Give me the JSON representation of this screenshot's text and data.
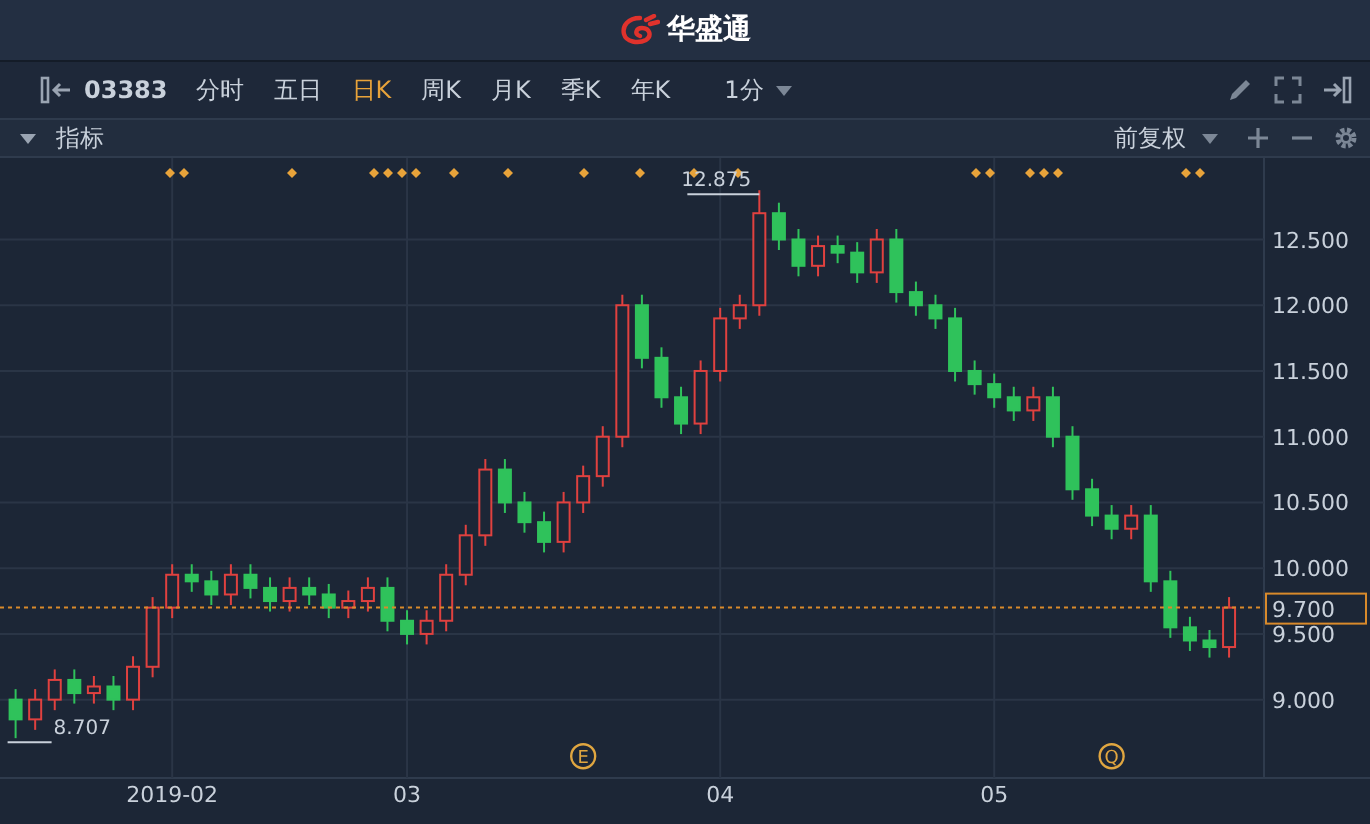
{
  "header": {
    "brand": "华盛通"
  },
  "toolbar": {
    "symbol": "03383",
    "tabs": [
      {
        "label": "分时",
        "selected": false
      },
      {
        "label": "五日",
        "selected": false
      },
      {
        "label": "日K",
        "selected": true
      },
      {
        "label": "周K",
        "selected": false
      },
      {
        "label": "月K",
        "selected": false
      },
      {
        "label": "季K",
        "selected": false
      },
      {
        "label": "年K",
        "selected": false
      }
    ],
    "interval": "1分"
  },
  "indicator_bar": {
    "label": "指标",
    "adjustment": "前复权"
  },
  "chart": {
    "chart_data": {
      "type": "candlestick",
      "grid": true,
      "ylim": [
        8.404,
        13.12
      ],
      "yticks": [
        {
          "value": 9,
          "label": "9.000"
        },
        {
          "value": 9.5,
          "label": "9.500"
        },
        {
          "value": 10,
          "label": "10.000"
        },
        {
          "value": 10.5,
          "label": "10.500"
        },
        {
          "value": 11,
          "label": "11.000"
        },
        {
          "value": 11.5,
          "label": "11.500"
        },
        {
          "value": 12,
          "label": "12.000"
        },
        {
          "value": 12.5,
          "label": "12.500"
        }
      ],
      "categories": [
        null,
        null,
        null,
        null,
        null,
        null,
        null,
        null,
        "2019-02",
        null,
        null,
        null,
        null,
        null,
        null,
        null,
        null,
        null,
        null,
        null,
        "03",
        null,
        null,
        null,
        null,
        null,
        null,
        null,
        null,
        null,
        null,
        null,
        null,
        null,
        null,
        null,
        "04",
        null,
        null,
        null,
        null,
        null,
        null,
        null,
        null,
        null,
        null,
        null,
        null,
        null,
        "05",
        null,
        null,
        null,
        null,
        null,
        null,
        null,
        null,
        null,
        null,
        null,
        null
      ],
      "ohlc": [
        [
          9.0,
          9.08,
          8.707,
          8.85
        ],
        [
          8.85,
          9.08,
          8.77,
          9.0
        ],
        [
          9.0,
          9.23,
          8.92,
          9.15
        ],
        [
          9.15,
          9.23,
          8.97,
          9.05
        ],
        [
          9.05,
          9.18,
          8.97,
          9.1
        ],
        [
          9.1,
          9.18,
          8.92,
          9.0
        ],
        [
          9.0,
          9.33,
          8.92,
          9.25
        ],
        [
          9.25,
          9.78,
          9.17,
          9.7
        ],
        [
          9.7,
          10.03,
          9.62,
          9.95
        ],
        [
          9.95,
          10.03,
          9.82,
          9.9
        ],
        [
          9.9,
          9.98,
          9.72,
          9.8
        ],
        [
          9.8,
          10.03,
          9.72,
          9.95
        ],
        [
          9.95,
          10.03,
          9.77,
          9.85
        ],
        [
          9.85,
          9.93,
          9.67,
          9.75
        ],
        [
          9.75,
          9.93,
          9.67,
          9.85
        ],
        [
          9.85,
          9.93,
          9.72,
          9.8
        ],
        [
          9.8,
          9.88,
          9.62,
          9.7
        ],
        [
          9.7,
          9.83,
          9.62,
          9.75
        ],
        [
          9.75,
          9.93,
          9.67,
          9.85
        ],
        [
          9.85,
          9.93,
          9.52,
          9.6
        ],
        [
          9.6,
          9.68,
          9.42,
          9.5
        ],
        [
          9.5,
          9.68,
          9.42,
          9.6
        ],
        [
          9.6,
          10.03,
          9.52,
          9.95
        ],
        [
          9.95,
          10.33,
          9.87,
          10.25
        ],
        [
          10.25,
          10.83,
          10.17,
          10.75
        ],
        [
          10.75,
          10.83,
          10.42,
          10.5
        ],
        [
          10.5,
          10.58,
          10.27,
          10.35
        ],
        [
          10.35,
          10.43,
          10.12,
          10.2
        ],
        [
          10.2,
          10.58,
          10.12,
          10.5
        ],
        [
          10.5,
          10.78,
          10.42,
          10.7
        ],
        [
          10.7,
          11.08,
          10.62,
          11.0
        ],
        [
          11.0,
          12.08,
          10.92,
          12.0
        ],
        [
          12.0,
          12.08,
          11.52,
          11.6
        ],
        [
          11.6,
          11.68,
          11.22,
          11.3
        ],
        [
          11.3,
          11.38,
          11.02,
          11.1
        ],
        [
          11.1,
          11.58,
          11.02,
          11.5
        ],
        [
          11.5,
          11.98,
          11.42,
          11.9
        ],
        [
          11.9,
          12.08,
          11.82,
          12.0
        ],
        [
          12.0,
          12.875,
          11.92,
          12.7
        ],
        [
          12.7,
          12.78,
          12.42,
          12.5
        ],
        [
          12.5,
          12.58,
          12.22,
          12.3
        ],
        [
          12.3,
          12.53,
          12.22,
          12.45
        ],
        [
          12.45,
          12.53,
          12.32,
          12.4
        ],
        [
          12.4,
          12.48,
          12.17,
          12.25
        ],
        [
          12.25,
          12.58,
          12.17,
          12.5
        ],
        [
          12.5,
          12.58,
          12.02,
          12.1
        ],
        [
          12.1,
          12.18,
          11.92,
          12.0
        ],
        [
          12.0,
          12.08,
          11.82,
          11.9
        ],
        [
          11.9,
          11.98,
          11.42,
          11.5
        ],
        [
          11.5,
          11.58,
          11.32,
          11.4
        ],
        [
          11.4,
          11.48,
          11.22,
          11.3
        ],
        [
          11.3,
          11.38,
          11.12,
          11.2
        ],
        [
          11.2,
          11.38,
          11.12,
          11.3
        ],
        [
          11.3,
          11.38,
          10.92,
          11.0
        ],
        [
          11.0,
          11.08,
          10.52,
          10.6
        ],
        [
          10.6,
          10.68,
          10.32,
          10.4
        ],
        [
          10.4,
          10.48,
          10.22,
          10.3
        ],
        [
          10.3,
          10.48,
          10.22,
          10.4
        ],
        [
          10.4,
          10.48,
          9.82,
          9.9
        ],
        [
          9.9,
          9.98,
          9.47,
          9.55
        ],
        [
          9.55,
          9.63,
          9.37,
          9.45
        ],
        [
          9.45,
          9.53,
          9.32,
          9.4
        ],
        [
          9.4,
          9.78,
          9.32,
          9.7
        ]
      ],
      "ref_lines": [
        {
          "axis": "y",
          "value": 9.7,
          "label": "9.700"
        }
      ],
      "annotations": [
        "12.875",
        "8.707"
      ]
    },
    "event_badges": [
      {
        "label": "E"
      },
      {
        "label": "Q"
      }
    ]
  }
}
